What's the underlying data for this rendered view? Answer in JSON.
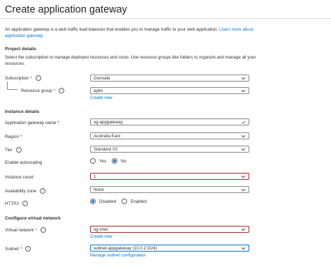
{
  "page": {
    "title": "Create application gateway",
    "description": "An application gateway is a web traffic load balancer that enables you to manage traffic to your web application.",
    "learn_more": "Learn more about application gateway"
  },
  "project_details": {
    "heading": "Project details",
    "description": "Select the subscription to manage deployed resources and costs. Use resource groups like folders to organize and manage all your resources.",
    "subscription": {
      "label": "Subscription",
      "required": "*",
      "value": "Gunnala"
    },
    "resource_group": {
      "label": "Resource group",
      "required": "*",
      "value": "apim",
      "create_new": "Create new"
    }
  },
  "instance_details": {
    "heading": "Instance details",
    "name": {
      "label": "Application gateway name",
      "required": "*",
      "value": "sg-appgateway"
    },
    "region": {
      "label": "Region",
      "required": "*",
      "value": "Australia East"
    },
    "tier": {
      "label": "Tier",
      "value": "Standard V2"
    },
    "autoscaling": {
      "label": "Enable autoscaling",
      "yes": "Yes",
      "no": "No",
      "selected": "No"
    },
    "instance_count": {
      "label": "Instance count",
      "value": "1"
    },
    "availability_zone": {
      "label": "Availability zone",
      "value": "None"
    },
    "http2": {
      "label": "HTTP2",
      "disabled": "Disabled",
      "enabled": "Enabled",
      "selected": "Disabled"
    }
  },
  "virtual_network": {
    "heading": "Configure virtual network",
    "vnet": {
      "label": "Virtual network",
      "required": "*",
      "value": "sg-vnet",
      "create_new": "Create new"
    },
    "subnet": {
      "label": "Subnet",
      "required": "*",
      "value": "subnet-appgateway (10.0.2.0/24)",
      "manage": "Manage subnet configuration"
    }
  },
  "colors": {
    "accent": "#0078d4",
    "error": "#a4262c",
    "success": "#107c10",
    "border": "#8a8886"
  }
}
